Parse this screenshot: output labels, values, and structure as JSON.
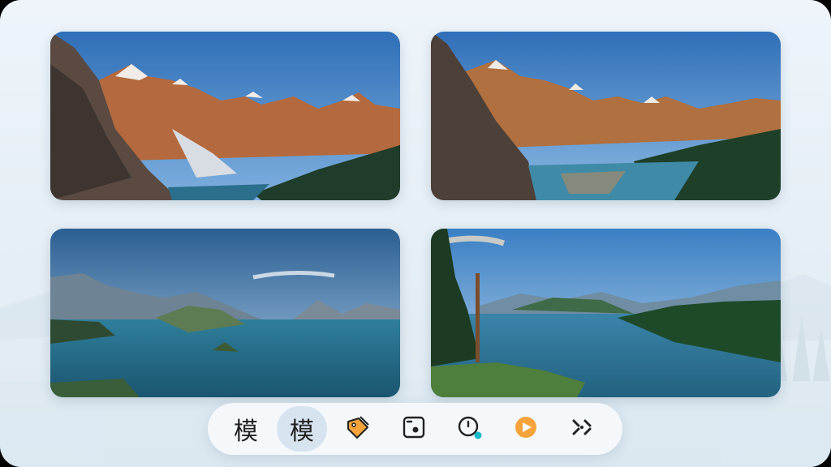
{
  "toolbar": {
    "mode_label_1": "模",
    "mode_label_2": "模",
    "active_index": 1,
    "tools": [
      {
        "icon": "paint-tag-icon"
      },
      {
        "icon": "image-frame-icon"
      },
      {
        "icon": "magnify-clock-icon"
      },
      {
        "icon": "play-circle-icon"
      },
      {
        "icon": "shuffle-scissors-icon"
      }
    ]
  },
  "colors": {
    "accent_orange": "#f5a33a",
    "accent_teal": "#18b8c6",
    "active_bg": "#d7e3ef"
  }
}
